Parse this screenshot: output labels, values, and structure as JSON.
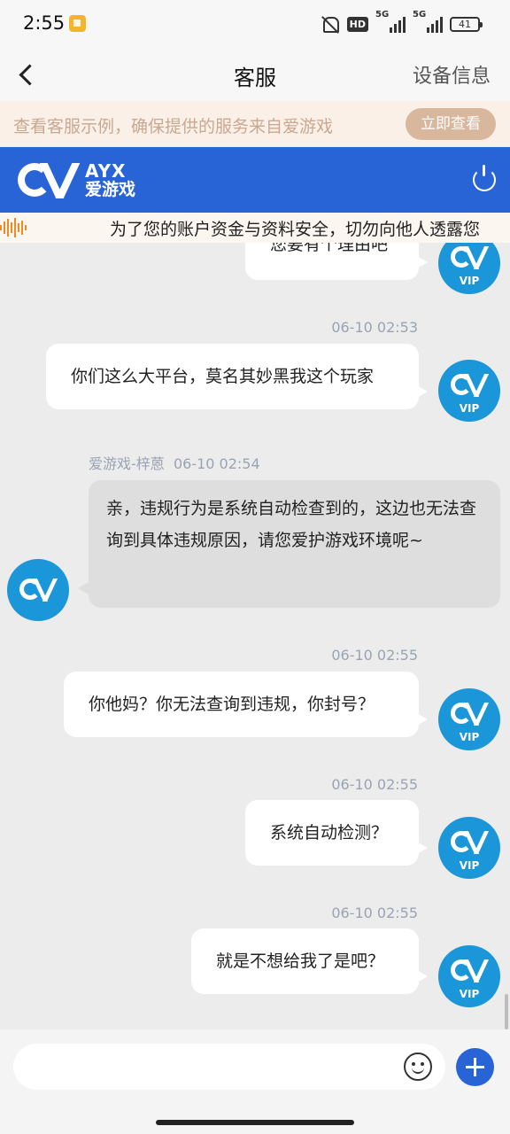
{
  "status_bar": {
    "time": "2:55",
    "hd_label": "HD",
    "net1": "5G",
    "net2": "5G",
    "battery": "41"
  },
  "nav": {
    "title": "客服",
    "device_info": "设备信息"
  },
  "notice": {
    "text": "查看客服示例，确保提供的服务来自爱游戏",
    "button": "立即查看"
  },
  "brand": {
    "logo_en": "AYX",
    "logo_cn": "爱游戏"
  },
  "marquee": {
    "text": "为了您的账户资金与资料安全，切勿向他人透露您"
  },
  "messages": [
    {
      "text": "您要有个理由吧"
    },
    {
      "time": "06-10 02:53",
      "text": "你们这么大平台，莫名其妙黑我这个玩家"
    },
    {
      "sender": "爱游戏-梓蒽",
      "time": "06-10 02:54",
      "text": "亲，违规行为是系统自动检查到的，这边也无法查询到具体违规原因，请您爱护游戏环境呢~"
    },
    {
      "time": "06-10 02:55",
      "text": "你他妈？你无法查询到违规，你封号？"
    },
    {
      "time": "06-10 02:55",
      "text": "系统自动检测？"
    },
    {
      "time": "06-10 02:55",
      "text": "就是不想给我了是吧？"
    }
  ],
  "avatar": {
    "vip_label": "VIP"
  },
  "input": {
    "placeholder": ""
  },
  "icons": [
    "back-icon",
    "power-icon",
    "emoji-icon",
    "plus-icon"
  ],
  "colors": {
    "primary": "#2864d6",
    "notice_btn": "#d9b79d",
    "timestamp": "#9aa3b3"
  }
}
